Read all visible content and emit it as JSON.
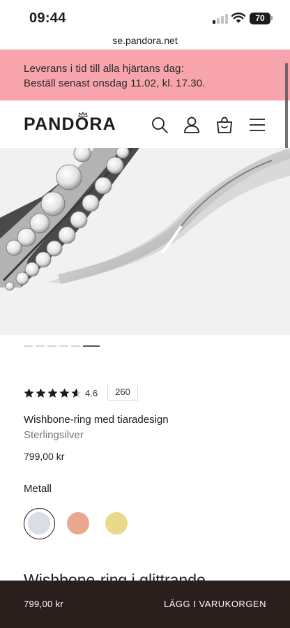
{
  "status_bar": {
    "time": "09:44",
    "battery": "70"
  },
  "browser": {
    "url": "se.pandora.net"
  },
  "promo": {
    "line1": "Leverans i tid till alla hjärtans dag:",
    "line2": "Beställ senast onsdag 11.02, kl. 17.30."
  },
  "header": {
    "logo": "PANDORA",
    "icons": [
      "search-icon",
      "account-icon",
      "shopping-bag-icon",
      "menu-icon"
    ]
  },
  "gallery": {
    "image_count": 6,
    "active_index": 5
  },
  "product": {
    "rating": "4.6",
    "rating_stars": 4.6,
    "review_count": "260",
    "name": "Wishbone-ring med tiaradesign",
    "material": "Sterlingsilver",
    "price": "799,00 kr"
  },
  "metal": {
    "label": "Metall",
    "options": [
      {
        "name": "silver",
        "color": "#d9dde6",
        "selected": true
      },
      {
        "name": "rose-gold",
        "color": "#eaa98f",
        "selected": false
      },
      {
        "name": "gold",
        "color": "#ead98a",
        "selected": false
      }
    ]
  },
  "description": {
    "heading_partial": "Wishbone-ring i glittrande"
  },
  "sticky": {
    "price": "799,00 kr",
    "cta": "LÄGG I VARUKORGEN"
  },
  "colors": {
    "promo_bg": "#f8a4ac",
    "sticky_bg": "#2a1f1d"
  }
}
